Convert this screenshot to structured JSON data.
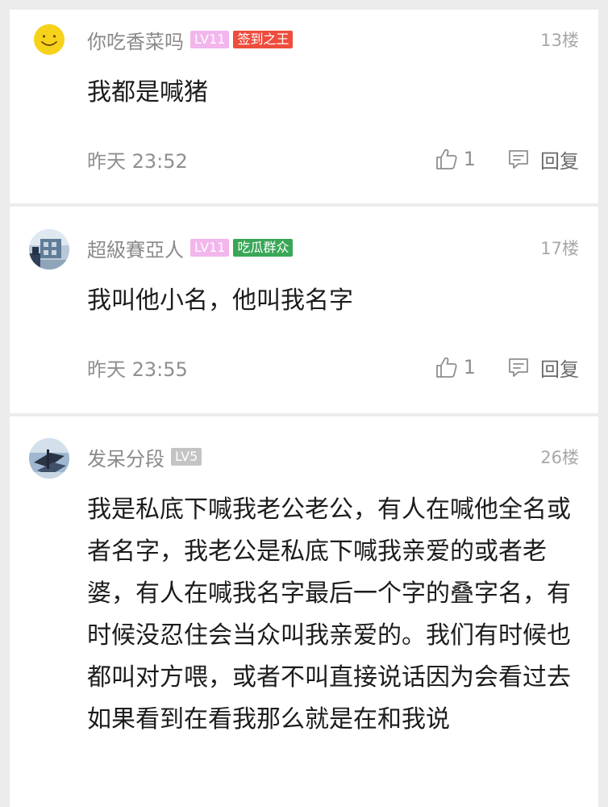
{
  "comments": [
    {
      "username": "你吃香菜吗",
      "level": "LV11",
      "badge": "签到之王",
      "badge_color": "#ee4d3d",
      "floor": "13楼",
      "content": "我都是喊猪",
      "time": "昨天 23:52",
      "likes": "1",
      "reply_label": "回复",
      "avatar": "smiley-face"
    },
    {
      "username": "超級賽亞人",
      "level": "LV11",
      "badge": "吃瓜群众",
      "badge_color": "#3aa757",
      "floor": "17楼",
      "content": "我叫他小名，他叫我名字",
      "time": "昨天 23:55",
      "likes": "1",
      "reply_label": "回复",
      "avatar": "photo"
    },
    {
      "username": "发呆分段",
      "level": "LV5",
      "floor": "26楼",
      "content": "我是私底下喊我老公老公，有人在喊他全名或者名字，我老公是私底下喊我亲爱的或者老婆，有人在喊我名字最后一个字的叠字名，有时候没忍住会当众叫我亲爱的。我们有时候也都叫对方喂，或者不叫直接说话因为会看过去如果看到在看我那么就是在和我说",
      "avatar": "photo"
    }
  ],
  "colors": {
    "background": "#ececec",
    "card": "#ffffff",
    "level_pink": "#f2b6ec",
    "level_gray": "#c4c4c4",
    "meta_text": "#8f8f8f"
  }
}
